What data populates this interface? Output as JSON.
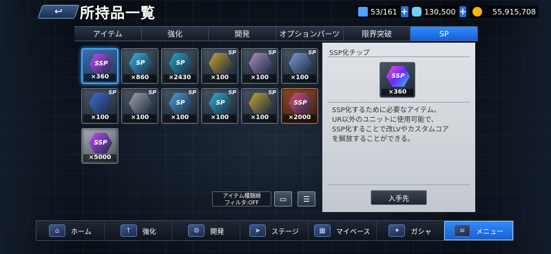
{
  "header": {
    "back_icon": "back-arrow-icon",
    "title": "所持品一覧",
    "resources": [
      {
        "name": "storage",
        "icon": "unit-storage-icon",
        "value": "53/161",
        "color": "#4aa3ff"
      },
      {
        "name": "credits",
        "icon": "capsule-icon",
        "value": "130,500",
        "color": "#6fd0ff"
      },
      {
        "name": "coins",
        "icon": "gold-coin-icon",
        "value": "55,915,708",
        "color": "#f5b400"
      }
    ],
    "plus_label": "+"
  },
  "tabs": [
    {
      "label": "アイテム",
      "active": false
    },
    {
      "label": "強化",
      "active": false
    },
    {
      "label": "開発",
      "active": false
    },
    {
      "label": "オプションパーツ",
      "active": false
    },
    {
      "label": "限界突破",
      "active": false
    },
    {
      "label": "SP",
      "active": true
    }
  ],
  "items": [
    {
      "icon": "sp-chip-icon",
      "glyph": "SSP",
      "count": "×360",
      "style": "selected",
      "color": "#c04bff"
    },
    {
      "icon": "sp-chip-icon",
      "glyph": "SP",
      "count": "×860",
      "style": "",
      "color": "#35b7e6"
    },
    {
      "icon": "sp-chip-icon",
      "glyph": "SP",
      "count": "×2430",
      "style": "",
      "color": "#2aa5c8"
    },
    {
      "icon": "series-chip-icon",
      "glyph": "",
      "count": "×100",
      "style": "",
      "color": "#c7a62e",
      "tag": "SP"
    },
    {
      "icon": "series-chip-icon",
      "glyph": "",
      "count": "×100",
      "style": "",
      "color": "#b38fc4",
      "tag": "SP"
    },
    {
      "icon": "series-chip-icon",
      "glyph": "",
      "count": "×100",
      "style": "",
      "color": "#7f9bd2",
      "tag": "SP"
    },
    {
      "icon": "series-chip-icon",
      "glyph": "",
      "count": "×100",
      "style": "",
      "color": "#3c6fd8",
      "tag": "SP"
    },
    {
      "icon": "series-chip-icon",
      "glyph": "",
      "count": "×100",
      "style": "",
      "color": "#a6a6a6",
      "tag": "SP"
    },
    {
      "icon": "sp-chip-icon",
      "glyph": "SP",
      "count": "×100",
      "style": "",
      "color": "#4d9fe0",
      "tag": "SP"
    },
    {
      "icon": "sp-chip-icon",
      "glyph": "SP",
      "count": "×100",
      "style": "",
      "color": "#2fb0d2",
      "tag": "SP"
    },
    {
      "icon": "series-chip-icon",
      "glyph": "",
      "count": "×100",
      "style": "",
      "color": "#c7a62e",
      "tag": "SP"
    },
    {
      "icon": "ssp-chip-icon",
      "glyph": "SSP",
      "count": "×2000",
      "style": "orange",
      "color": "#e34a7a"
    },
    {
      "icon": "ssp-chip-icon",
      "glyph": "SSP",
      "count": "×5000",
      "style": "silver",
      "color": "#c04bff"
    }
  ],
  "detail": {
    "title": "SSP化チップ",
    "icon": "ssp-chip-icon",
    "glyph": "SSP",
    "count": "×360",
    "description_lines": [
      "SSP化するために必要なアイテム。",
      "UR以外のユニットに使用可能で、",
      "SSP化することで改LVやカスタムコア",
      "を解放することができる。"
    ],
    "source_button": "入手先"
  },
  "filter": {
    "line1": "アイテム種類順",
    "line2": "フィルタ:OFF",
    "view_icon": "card-view-icon",
    "sort_icon": "sort-icon"
  },
  "nav": [
    {
      "label": "ホーム",
      "icon": "home-icon",
      "active": false
    },
    {
      "label": "強化",
      "icon": "enhance-icon",
      "active": false
    },
    {
      "label": "開発",
      "icon": "develop-icon",
      "active": false
    },
    {
      "label": "ステージ",
      "icon": "stage-icon",
      "active": false
    },
    {
      "label": "マイベース",
      "icon": "base-icon",
      "active": false
    },
    {
      "label": "ガシャ",
      "icon": "gacha-icon",
      "active": false
    },
    {
      "label": "メニュー",
      "icon": "menu-icon",
      "active": true
    }
  ]
}
